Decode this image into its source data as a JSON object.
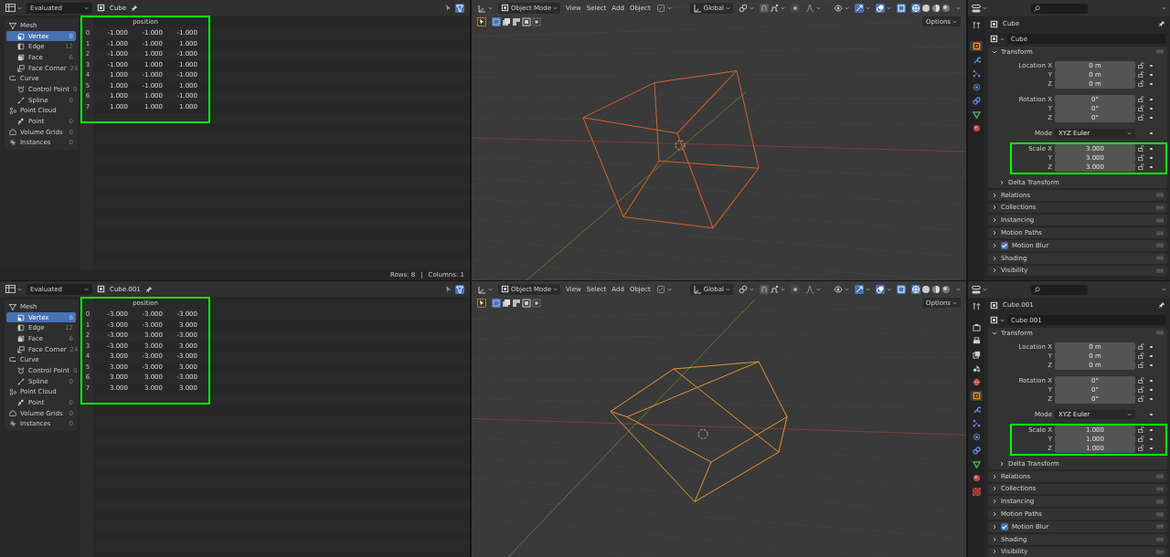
{
  "rows": [
    {
      "spreadsheet": {
        "header": {
          "evaluation": "Evaluated",
          "object": "Cube"
        },
        "sidebar": [
          {
            "label": "Mesh",
            "selected": false,
            "children": [
              {
                "label": "Vertex",
                "count": "8",
                "selected": true
              },
              {
                "label": "Edge",
                "count": "12",
                "selected": false
              },
              {
                "label": "Face",
                "count": "6",
                "selected": false
              },
              {
                "label": "Face Corner",
                "count": "24",
                "selected": false
              }
            ]
          },
          {
            "label": "Curve",
            "selected": false,
            "children": [
              {
                "label": "Control Point",
                "count": "0",
                "selected": false
              },
              {
                "label": "Spline",
                "count": "0",
                "selected": false
              }
            ]
          },
          {
            "label": "Point Cloud",
            "selected": false,
            "children": [
              {
                "label": "Point",
                "count": "0",
                "selected": false
              }
            ]
          },
          {
            "label": "Volume Grids",
            "count": "0",
            "selected": false
          },
          {
            "label": "Instances",
            "count": "0",
            "selected": false
          }
        ],
        "table": {
          "highlighted": true,
          "columns": [
            "position"
          ],
          "rows": [
            {
              "index": "0",
              "values": [
                "-1.000",
                "-1.000",
                "-1.000"
              ]
            },
            {
              "index": "1",
              "values": [
                "-1.000",
                "-1.000",
                "1.000"
              ]
            },
            {
              "index": "2",
              "values": [
                "-1.000",
                "1.000",
                "-1.000"
              ]
            },
            {
              "index": "3",
              "values": [
                "-1.000",
                "1.000",
                "1.000"
              ]
            },
            {
              "index": "4",
              "values": [
                "1.000",
                "-1.000",
                "-1.000"
              ]
            },
            {
              "index": "5",
              "values": [
                "1.000",
                "-1.000",
                "1.000"
              ]
            },
            {
              "index": "6",
              "values": [
                "1.000",
                "1.000",
                "-1.000"
              ]
            },
            {
              "index": "7",
              "values": [
                "1.000",
                "1.000",
                "1.000"
              ]
            }
          ]
        },
        "footer": {
          "rows": "Rows: 8",
          "separator": "|",
          "columns": "Columns: 1"
        }
      },
      "viewport": {
        "header": {
          "mode": "Object Mode",
          "menus": [
            "View",
            "Select",
            "Add",
            "Object"
          ],
          "orientation": "Global",
          "options": "Options"
        },
        "cube": {
          "color": "#d8602a"
        }
      },
      "properties": {
        "tabs": [
          {
            "kind": "tool",
            "selected": false
          },
          {
            "kind": "object",
            "selected": true
          },
          {
            "kind": "modifiers",
            "selected": false
          },
          {
            "kind": "particles",
            "selected": false
          },
          {
            "kind": "physics",
            "selected": false
          },
          {
            "kind": "constraints",
            "selected": false
          },
          {
            "kind": "data",
            "selected": false
          },
          {
            "kind": "material",
            "selected": false
          }
        ],
        "object": "Cube",
        "name_field": "Cube",
        "transform": {
          "label": "Transform",
          "expanded": true,
          "groups": [
            {
              "highlighted": false,
              "fields": [
                {
                  "label": "Location X",
                  "value": "0 m",
                  "kind": "number"
                },
                {
                  "label": "Y",
                  "value": "0 m",
                  "kind": "number"
                },
                {
                  "label": "Z",
                  "value": "0 m",
                  "kind": "number"
                }
              ]
            },
            {
              "highlighted": false,
              "fields": [
                {
                  "label": "Rotation X",
                  "value": "0°",
                  "kind": "number"
                },
                {
                  "label": "Y",
                  "value": "0°",
                  "kind": "number"
                },
                {
                  "label": "Z",
                  "value": "0°",
                  "kind": "number"
                }
              ]
            },
            {
              "highlighted": false,
              "fields": [
                {
                  "label": "Mode",
                  "value": "XYZ Euler",
                  "kind": "dropdown"
                }
              ]
            },
            {
              "highlighted": true,
              "fields": [
                {
                  "label": "Scale X",
                  "value": "3.000",
                  "kind": "number"
                },
                {
                  "label": "Y",
                  "value": "3.000",
                  "kind": "number"
                },
                {
                  "label": "Z",
                  "value": "3.000",
                  "kind": "number"
                }
              ]
            }
          ],
          "subpanels": [
            {
              "label": "Delta Transform",
              "expanded": false
            }
          ]
        },
        "panels": [
          {
            "label": "Relations",
            "expanded": false,
            "kind": "plain"
          },
          {
            "label": "Collections",
            "expanded": false,
            "kind": "plain"
          },
          {
            "label": "Instancing",
            "expanded": false,
            "kind": "plain"
          },
          {
            "label": "Motion Paths",
            "expanded": false,
            "kind": "plain"
          },
          {
            "label": "Motion Blur",
            "expanded": false,
            "kind": "checkbox",
            "checked": true
          },
          {
            "label": "Shading",
            "expanded": false,
            "kind": "plain"
          },
          {
            "label": "Visibility",
            "expanded": false,
            "kind": "plain"
          }
        ]
      }
    },
    {
      "spreadsheet": {
        "header": {
          "evaluation": "Evaluated",
          "object": "Cube.001"
        },
        "sidebar": [
          {
            "label": "Mesh",
            "selected": false,
            "children": [
              {
                "label": "Vertex",
                "count": "8",
                "selected": true
              },
              {
                "label": "Edge",
                "count": "12",
                "selected": false
              },
              {
                "label": "Face",
                "count": "6",
                "selected": false
              },
              {
                "label": "Face Corner",
                "count": "24",
                "selected": false
              }
            ]
          },
          {
            "label": "Curve",
            "selected": false,
            "children": [
              {
                "label": "Control Point",
                "count": "0",
                "selected": false
              },
              {
                "label": "Spline",
                "count": "0",
                "selected": false
              }
            ]
          },
          {
            "label": "Point Cloud",
            "selected": false,
            "children": [
              {
                "label": "Point",
                "count": "0",
                "selected": false
              }
            ]
          },
          {
            "label": "Volume Grids",
            "count": "0",
            "selected": false
          },
          {
            "label": "Instances",
            "count": "0",
            "selected": false
          }
        ],
        "table": {
          "highlighted": true,
          "columns": [
            "position"
          ],
          "rows": [
            {
              "index": "0",
              "values": [
                "-3.000",
                "-3.000",
                "-3.000"
              ]
            },
            {
              "index": "1",
              "values": [
                "-3.000",
                "-3.000",
                "3.000"
              ]
            },
            {
              "index": "2",
              "values": [
                "-3.000",
                "3.000",
                "-3.000"
              ]
            },
            {
              "index": "3",
              "values": [
                "-3.000",
                "3.000",
                "3.000"
              ]
            },
            {
              "index": "4",
              "values": [
                "3.000",
                "-3.000",
                "-3.000"
              ]
            },
            {
              "index": "5",
              "values": [
                "3.000",
                "-3.000",
                "3.000"
              ]
            },
            {
              "index": "6",
              "values": [
                "3.000",
                "3.000",
                "-3.000"
              ]
            },
            {
              "index": "7",
              "values": [
                "3.000",
                "3.000",
                "3.000"
              ]
            }
          ]
        }
      },
      "viewport": {
        "header": {
          "mode": "Object Mode",
          "menus": [
            "View",
            "Select",
            "Add",
            "Object"
          ],
          "orientation": "Global",
          "options": "Options"
        },
        "cube": {
          "color": "#e8952e"
        }
      },
      "properties": {
        "tabs": [
          {
            "kind": "tool",
            "selected": false
          },
          {
            "kind": "render",
            "selected": false
          },
          {
            "kind": "output",
            "selected": false
          },
          {
            "kind": "view_layer",
            "selected": false
          },
          {
            "kind": "scene",
            "selected": false
          },
          {
            "kind": "world",
            "selected": false
          },
          {
            "kind": "object",
            "selected": true
          },
          {
            "kind": "modifiers",
            "selected": false
          },
          {
            "kind": "particles",
            "selected": false
          },
          {
            "kind": "physics",
            "selected": false
          },
          {
            "kind": "constraints",
            "selected": false
          },
          {
            "kind": "data",
            "selected": false
          },
          {
            "kind": "material",
            "selected": false
          },
          {
            "kind": "texture",
            "selected": false
          }
        ],
        "object": "Cube.001",
        "name_field": "Cube.001",
        "transform": {
          "label": "Transform",
          "expanded": true,
          "groups": [
            {
              "highlighted": false,
              "fields": [
                {
                  "label": "Location X",
                  "value": "0 m",
                  "kind": "number"
                },
                {
                  "label": "Y",
                  "value": "0 m",
                  "kind": "number"
                },
                {
                  "label": "Z",
                  "value": "0 m",
                  "kind": "number"
                }
              ]
            },
            {
              "highlighted": false,
              "fields": [
                {
                  "label": "Rotation X",
                  "value": "0°",
                  "kind": "number"
                },
                {
                  "label": "Y",
                  "value": "0°",
                  "kind": "number"
                },
                {
                  "label": "Z",
                  "value": "0°",
                  "kind": "number"
                }
              ]
            },
            {
              "highlighted": false,
              "fields": [
                {
                  "label": "Mode",
                  "value": "XYZ Euler",
                  "kind": "dropdown"
                }
              ]
            },
            {
              "highlighted": true,
              "fields": [
                {
                  "label": "Scale X",
                  "value": "1.000",
                  "kind": "number"
                },
                {
                  "label": "Y",
                  "value": "1.000",
                  "kind": "number"
                },
                {
                  "label": "Z",
                  "value": "1.000",
                  "kind": "number"
                }
              ]
            }
          ],
          "subpanels": [
            {
              "label": "Delta Transform",
              "expanded": false
            }
          ]
        },
        "panels": [
          {
            "label": "Relations",
            "expanded": false,
            "kind": "plain"
          },
          {
            "label": "Collections",
            "expanded": false,
            "kind": "plain"
          },
          {
            "label": "Instancing",
            "expanded": false,
            "kind": "plain"
          },
          {
            "label": "Motion Paths",
            "expanded": false,
            "kind": "plain"
          },
          {
            "label": "Motion Blur",
            "expanded": false,
            "kind": "checkbox",
            "checked": true
          },
          {
            "label": "Shading",
            "expanded": false,
            "kind": "plain"
          },
          {
            "label": "Visibility",
            "expanded": false,
            "kind": "plain"
          }
        ]
      }
    }
  ]
}
